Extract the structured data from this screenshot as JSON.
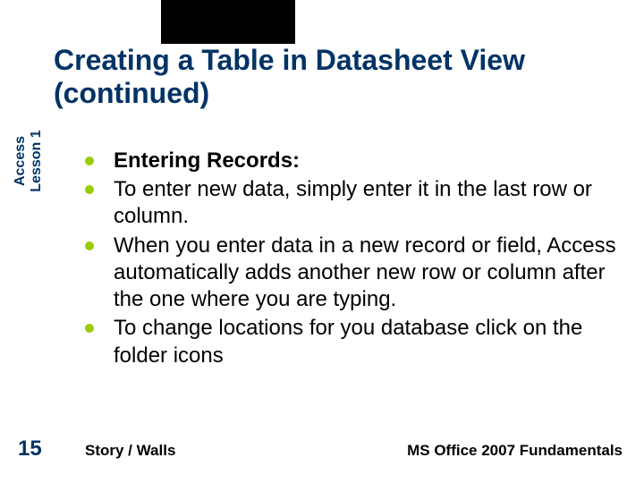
{
  "title": "Creating a Table in Datasheet View (continued)",
  "sidebar": {
    "line1": "Access",
    "line2": "Lesson 1"
  },
  "bullets": [
    {
      "text": "Entering Records:",
      "bold": true
    },
    {
      "text": "To enter new data, simply enter it in the last row or column.",
      "bold": false
    },
    {
      "text": "When you enter data in a new record or field, Access automatically adds another new row or column after the one where you are typing.",
      "bold": false
    },
    {
      "text": "To change locations for you database click on the folder icons",
      "bold": false
    }
  ],
  "page_number": "15",
  "footer": {
    "left": "Story / Walls",
    "right": "MS Office 2007 Fundamentals"
  }
}
